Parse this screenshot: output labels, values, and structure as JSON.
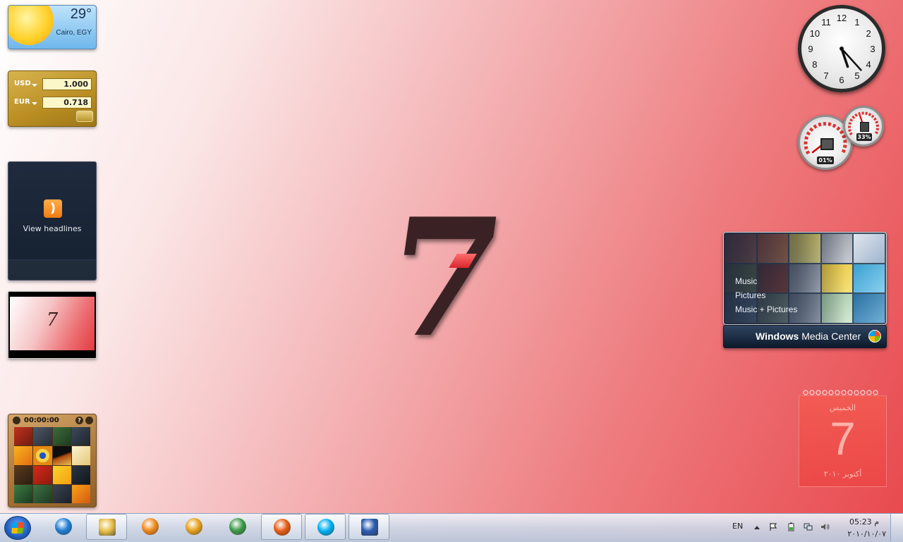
{
  "wallpaper": {
    "logo_text": "7"
  },
  "weather": {
    "temperature": "29°",
    "location": "Cairo, EGY"
  },
  "currency": {
    "rows": [
      {
        "code": "USD",
        "value": "1.000"
      },
      {
        "code": "EUR",
        "value": "0.718"
      }
    ]
  },
  "feed": {
    "label": "View headlines"
  },
  "slideshow": {
    "caption": "7"
  },
  "puzzle": {
    "timer": "00:00:00",
    "help": "?"
  },
  "clock": {
    "numbers": [
      "12",
      "1",
      "2",
      "3",
      "4",
      "5",
      "6",
      "7",
      "8",
      "9",
      "10",
      "11"
    ],
    "hour": 5,
    "minute": 23
  },
  "cpu_meter": {
    "cpu_percent": "01%",
    "memory_percent": "33%"
  },
  "media_center": {
    "items": [
      "Music",
      "Pictures",
      "Music + Pictures"
    ],
    "title_bold": "Windows",
    "title_rest": " Media Center"
  },
  "calendar": {
    "weekday": "الخميس",
    "day": "7",
    "month_year": "أكتوبر ٢٠١٠"
  },
  "taskbar": {
    "apps": [
      {
        "name": "Internet Explorer",
        "icon": "ie-icon",
        "pinned": false,
        "color": "#1f7fd6"
      },
      {
        "name": "Windows Explorer",
        "icon": "folder-icon",
        "pinned": true,
        "color": "#e9c04a"
      },
      {
        "name": "Windows Media Player",
        "icon": "media-player-icon",
        "pinned": false,
        "color": "#f08a1b"
      },
      {
        "name": "Winamp",
        "icon": "winamp-icon",
        "pinned": false,
        "color": "#e7a21e"
      },
      {
        "name": "Google Chrome",
        "icon": "chrome-icon",
        "pinned": false,
        "color": "#3c9a47"
      },
      {
        "name": "Firefox",
        "icon": "firefox-icon",
        "pinned": true,
        "color": "#e55b13"
      },
      {
        "name": "Skype",
        "icon": "skype-icon",
        "pinned": true,
        "color": "#00aff0"
      },
      {
        "name": "Microsoft Word",
        "icon": "word-icon",
        "pinned": true,
        "color": "#2b5bb0"
      }
    ],
    "tray": {
      "language": "EN",
      "time": "05:23 م",
      "date": "٢٠١٠/١٠/٠٧"
    }
  },
  "colors": {
    "wallpaper_start": "#ffffff",
    "wallpaper_end": "#e8484d",
    "accent_red": "#d8262c"
  }
}
